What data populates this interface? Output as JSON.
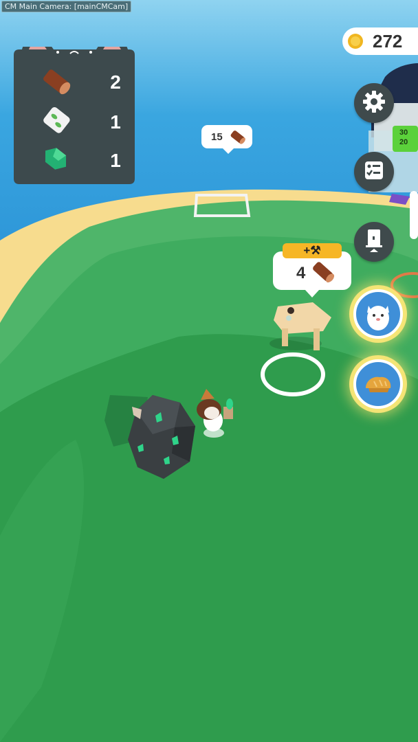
{
  "debug": {
    "camera_label": "CM Main Camera: [mainCMCam]"
  },
  "inventory": {
    "items": [
      {
        "icon": "wood-log-icon",
        "count": "2"
      },
      {
        "icon": "leaf-scroll-icon",
        "count": "1"
      },
      {
        "icon": "green-crystal-icon",
        "count": "1"
      }
    ]
  },
  "currency": {
    "icon": "coin-icon",
    "amount": "272"
  },
  "side_buttons": [
    {
      "icon": "gear-icon"
    },
    {
      "icon": "quest-list-icon"
    },
    {
      "icon": "door-upgrade-icon"
    },
    {
      "icon": "cat-character-icon",
      "highlighted": true
    },
    {
      "icon": "bread-food-icon",
      "highlighted": true
    }
  ],
  "build_spots": [
    {
      "cost": "15",
      "icon": "wood-log-icon"
    },
    {
      "badge": "+⚒",
      "cost": "4",
      "icon": "wood-log-icon"
    }
  ],
  "remote_sign": {
    "values": [
      "30",
      "20"
    ]
  },
  "colors": {
    "sea": "#3aa6e0",
    "sand": "#f7dc8e",
    "grass_light": "#4fb56a",
    "grass_dark": "#2e9a4d",
    "panel": "#3d4a4d",
    "highlight": "#f6d75a"
  }
}
